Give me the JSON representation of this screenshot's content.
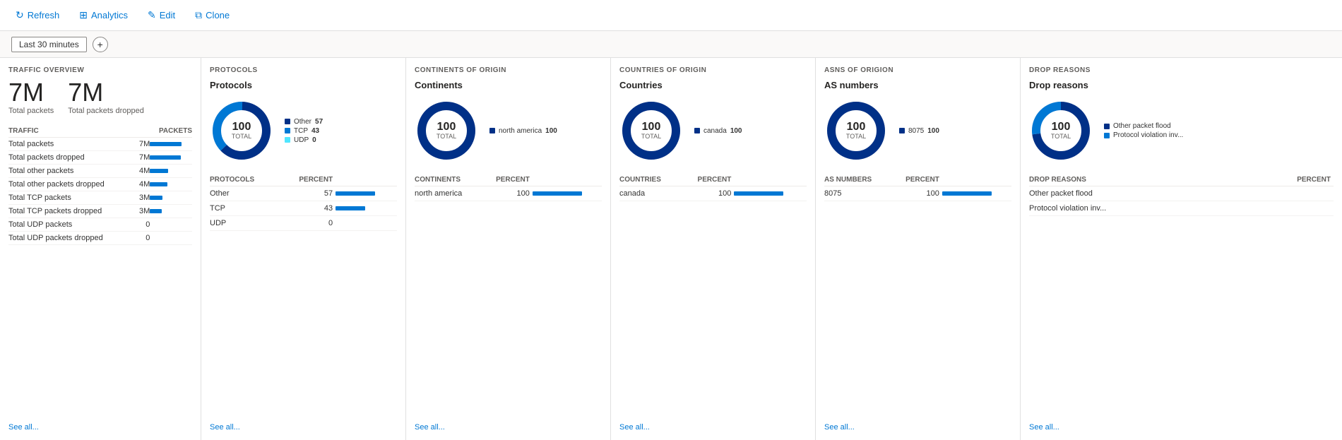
{
  "toolbar": {
    "refresh_label": "Refresh",
    "analytics_label": "Analytics",
    "edit_label": "Edit",
    "clone_label": "Clone"
  },
  "filter": {
    "time_label": "Last 30 minutes",
    "add_label": "+"
  },
  "traffic_overview": {
    "section_title": "TRAFFIC OVERVIEW",
    "total_packets_num": "7M",
    "total_packets_label": "Total packets",
    "total_packets_dropped_num": "7M",
    "total_packets_dropped_label": "Total packets dropped",
    "table_col1": "TRAFFIC",
    "table_col2": "PACKETS",
    "rows": [
      {
        "label": "Total packets",
        "value": "7M",
        "bar": 90
      },
      {
        "label": "Total packets dropped",
        "value": "7M",
        "bar": 88
      },
      {
        "label": "Total other packets",
        "value": "4M",
        "bar": 52
      },
      {
        "label": "Total other packets dropped",
        "value": "4M",
        "bar": 50
      },
      {
        "label": "Total TCP packets",
        "value": "3M",
        "bar": 35
      },
      {
        "label": "Total TCP packets dropped",
        "value": "3M",
        "bar": 33
      },
      {
        "label": "Total UDP packets",
        "value": "0",
        "bar": 0
      },
      {
        "label": "Total UDP packets dropped",
        "value": "0",
        "bar": 0
      }
    ],
    "see_all": "See all..."
  },
  "protocols": {
    "section_title": "PROTOCOLS",
    "chart_title": "Protocols",
    "total": "100",
    "total_label": "TOTAL",
    "legend": [
      {
        "label": "Other",
        "value": "57",
        "color": "#003087",
        "bar": 80
      },
      {
        "label": "TCP",
        "value": "43",
        "color": "#0078d4",
        "bar": 60
      },
      {
        "label": "UDP",
        "value": "0",
        "color": "#50e6ff",
        "bar": 0
      }
    ],
    "table_col1": "PROTOCOLS",
    "table_col2": "PERCENT",
    "rows": [
      {
        "label": "Other",
        "value": "57",
        "bar": 80
      },
      {
        "label": "TCP",
        "value": "43",
        "bar": 60
      },
      {
        "label": "UDP",
        "value": "0",
        "bar": 0
      }
    ],
    "see_all": "See all..."
  },
  "continents": {
    "section_title": "CONTINENTS OF ORIGIN",
    "chart_title": "Continents",
    "total": "100",
    "total_label": "TOTAL",
    "legend": [
      {
        "label": "north america",
        "value": "100",
        "color": "#003087",
        "bar": 100
      }
    ],
    "table_col1": "CONTINENTS",
    "table_col2": "PERCENT",
    "rows": [
      {
        "label": "north america",
        "value": "100",
        "bar": 100
      }
    ],
    "see_all": "See all..."
  },
  "countries": {
    "section_title": "COUNTRIES OF ORIGIN",
    "chart_title": "Countries",
    "total": "100",
    "total_label": "TOTAL",
    "legend": [
      {
        "label": "canada",
        "value": "100",
        "color": "#003087",
        "bar": 100
      }
    ],
    "table_col1": "COUNTRIES",
    "table_col2": "PERCENT",
    "rows": [
      {
        "label": "canada",
        "value": "100",
        "bar": 100
      }
    ],
    "see_all": "See all..."
  },
  "asns": {
    "section_title": "ASNS OF ORIGION",
    "chart_title": "AS numbers",
    "total": "100",
    "total_label": "TOTAL",
    "legend": [
      {
        "label": "8075",
        "value": "100",
        "color": "#003087",
        "bar": 100
      }
    ],
    "table_col1": "AS NUMBERS",
    "table_col2": "PERCENT",
    "rows": [
      {
        "label": "8075",
        "value": "100",
        "bar": 100
      }
    ],
    "see_all": "See all..."
  },
  "drop_reasons": {
    "section_title": "DROP REASONS",
    "chart_title": "Drop reasons",
    "total": "100",
    "total_label": "TOTAL",
    "legend": [
      {
        "label": "Other packet flood",
        "color": "#003087"
      },
      {
        "label": "Protocol violation inv...",
        "color": "#0078d4"
      }
    ],
    "table_col1": "DROP REASONS",
    "table_col2": "PERCENT",
    "rows": [
      {
        "label": "Other packet flood",
        "value": "",
        "bar": 0
      },
      {
        "label": "Protocol violation inv...",
        "value": "",
        "bar": 0
      }
    ],
    "see_all": "See all..."
  }
}
